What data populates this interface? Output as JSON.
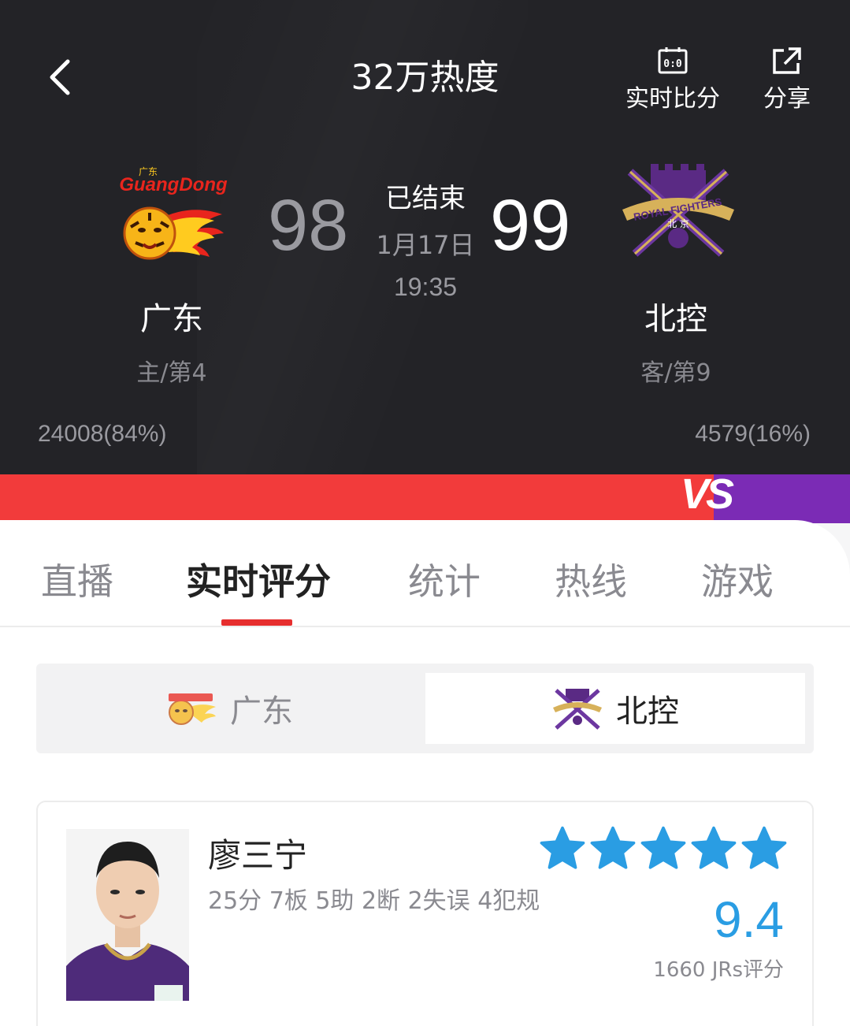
{
  "header": {
    "heat_title": "32万热度",
    "live_score_label": "实时比分",
    "live_score_icon_text": "0:0",
    "share_label": "分享"
  },
  "match": {
    "status": "已结束",
    "date": "1月17日",
    "time": "19:35",
    "home": {
      "name": "广东",
      "score": "98",
      "rank": "主/第4",
      "support": "24008(84%)",
      "logo_text": "GuangDong",
      "logo_text_cn": "广东"
    },
    "away": {
      "name": "北控",
      "score": "99",
      "rank": "客/第9",
      "support": "4579(16%)",
      "logo_text": "ROYAL FIGHTERS",
      "logo_text_cn": "北 京"
    },
    "support_split": {
      "home_fraction": 0.84,
      "away_fraction": 0.16
    },
    "vs_label": "VS"
  },
  "tabs": [
    {
      "label": "直播",
      "active": false
    },
    {
      "label": "实时评分",
      "active": true
    },
    {
      "label": "统计",
      "active": false
    },
    {
      "label": "热线",
      "active": false
    },
    {
      "label": "游戏",
      "active": false
    }
  ],
  "team_switch": {
    "home_label": "广东",
    "away_label": "北控",
    "selected": "away"
  },
  "player_card": {
    "name": "廖三宁",
    "stats": "25分 7板 5助 2断 2失误 4犯规",
    "stars": 5,
    "rating": "9.4",
    "raters": "1660 JRs评分"
  },
  "colors": {
    "header_bg": "#232327",
    "accent_red": "#f23b3b",
    "away_purple": "#7b2bb5",
    "rating_blue": "#2a9de3",
    "tab_underline": "#e62e2e"
  }
}
